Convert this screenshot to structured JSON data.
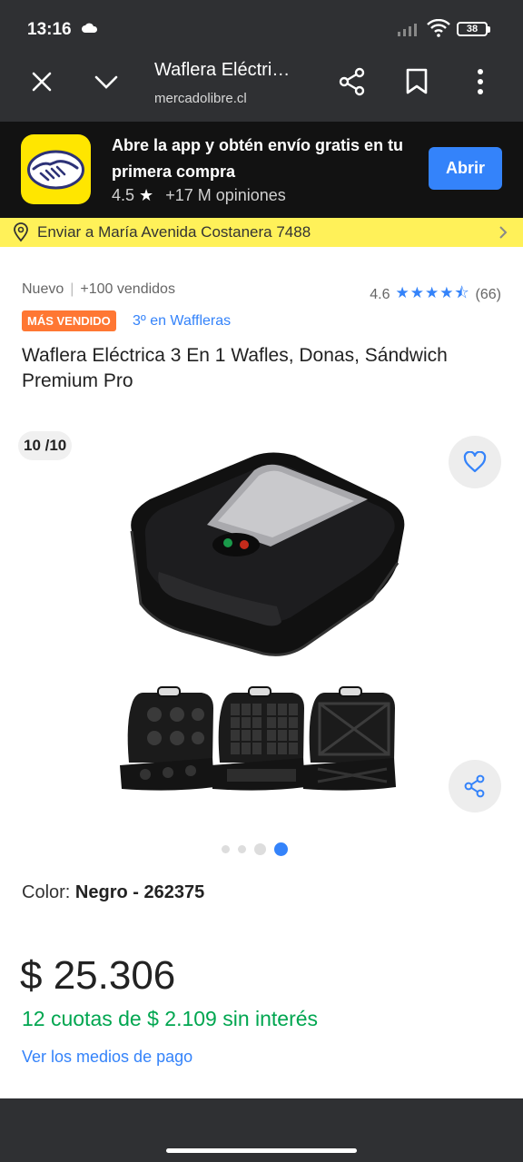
{
  "status": {
    "time": "13:16",
    "battery": "38"
  },
  "browser": {
    "title": "Waflera Eléctri…",
    "url": "mercadolibre.cl"
  },
  "app_banner": {
    "text": "Abre la app y obtén envío gratis en tu primera compra",
    "rating": "4.5",
    "reviews": "+17 M opiniones",
    "open_label": "Abrir"
  },
  "address": {
    "text": "Enviar a María Avenida Costanera 7488"
  },
  "product": {
    "condition": "Nuevo",
    "sold": "+100 vendidos",
    "rating": "4.6",
    "stars": "★★★★⯪",
    "reviews_count": "(66)",
    "badge": "MÁS VENDIDO",
    "rank": "3º en Waffleras",
    "title": "Waflera Eléctrica 3 En 1 Wafles, Donas, Sándwich Premium Pro"
  },
  "gallery": {
    "counter": "10 /10",
    "total_dots": 4,
    "active_dot": 4
  },
  "color": {
    "label": "Color: ",
    "value": "Negro - 262375"
  },
  "price": {
    "amount": "$ 25.306",
    "installments": "12 cuotas de $ 2.109 sin interés",
    "payment_link": "Ver los medios de pago"
  },
  "colors": {
    "accent": "#3483fa",
    "brand_yellow": "#fff159",
    "green": "#00a650",
    "badge_orange": "#ff7733"
  }
}
